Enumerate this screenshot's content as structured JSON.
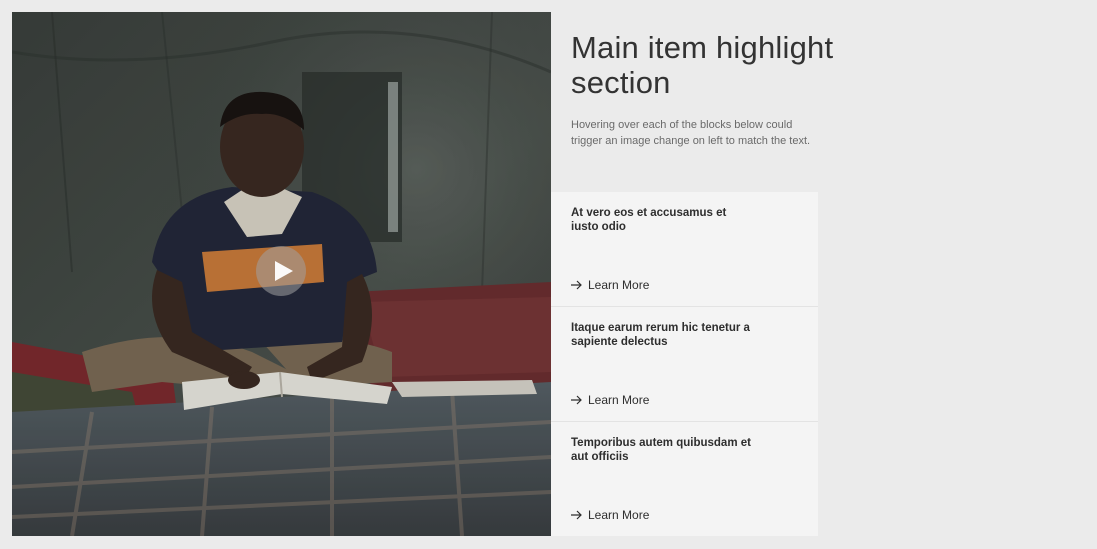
{
  "hero": {
    "title": "Main item highlight section",
    "description": "Hovering over each of the blocks below could trigger an image change on left to match the text."
  },
  "media": {
    "play_icon": "play-icon"
  },
  "cards": [
    {
      "heading": "At vero eos et accusamus et iusto odio",
      "link_label": "Learn More",
      "icon": "arrow-right-icon"
    },
    {
      "heading": "Itaque earum rerum hic tenetur a sapiente delectus",
      "link_label": "Learn More",
      "icon": "arrow-right-icon"
    },
    {
      "heading": "Temporibus autem quibusdam et aut officiis",
      "link_label": "Learn More",
      "icon": "arrow-right-icon"
    }
  ],
  "colors": {
    "page_background": "#ebebeb",
    "card_background": "#f4f4f4",
    "text": "#2e2e2e",
    "muted_text": "#6a6a6a"
  }
}
